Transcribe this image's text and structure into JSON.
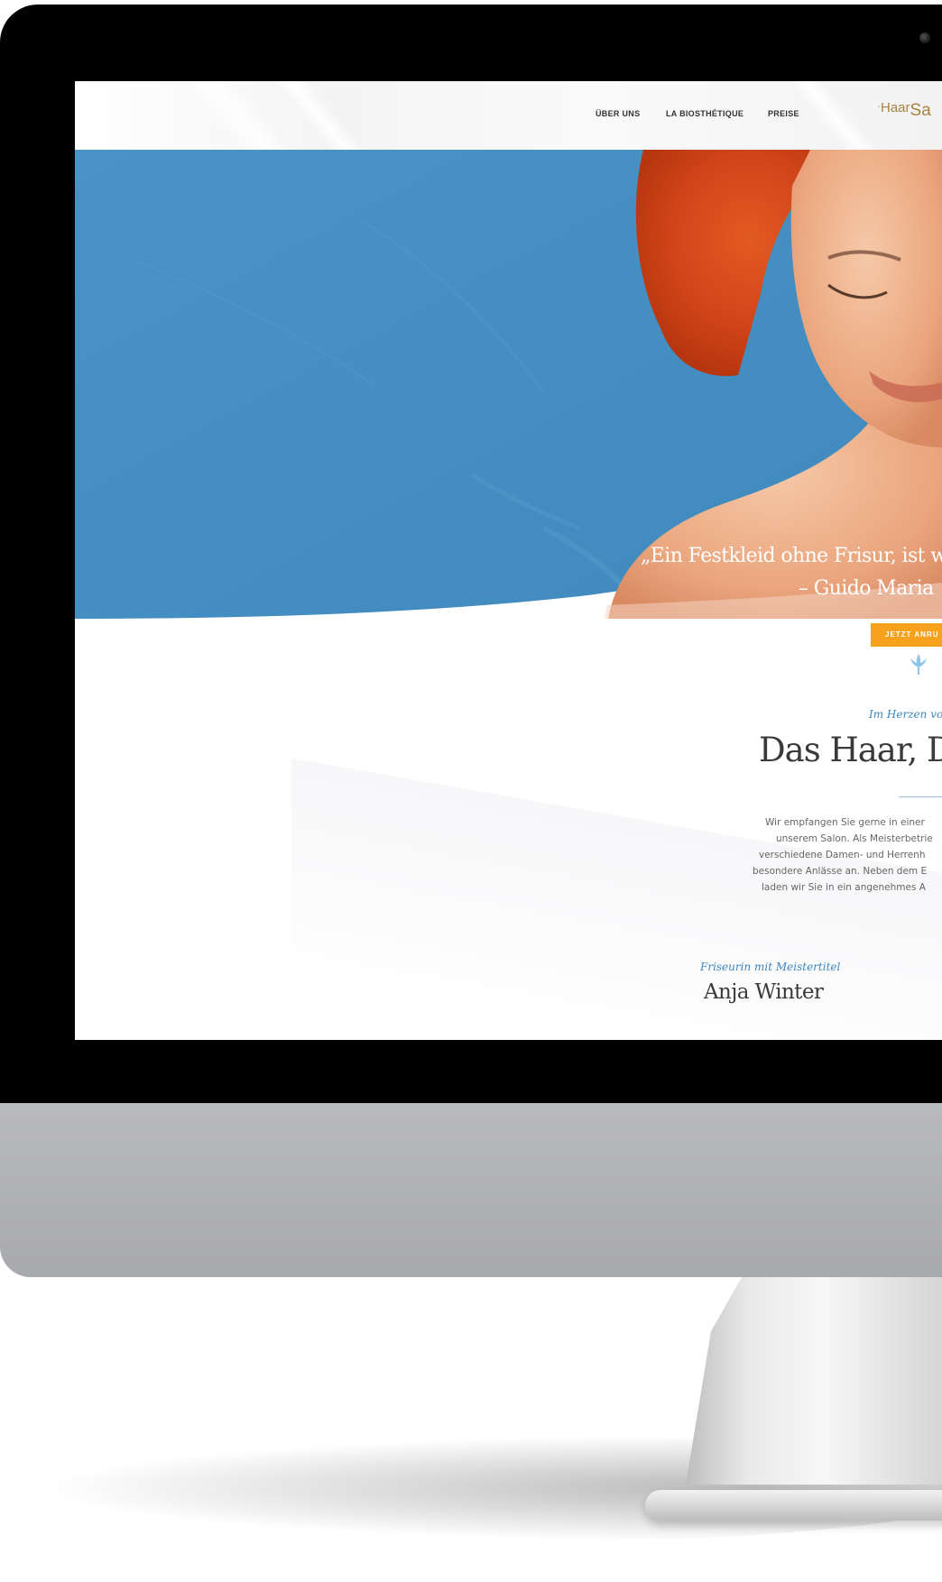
{
  "nav": {
    "items": [
      {
        "label": "ÜBER UNS"
      },
      {
        "label": "LA BIOSTHÉTIQUE"
      },
      {
        "label": "PREISE"
      }
    ]
  },
  "logo": {
    "line1": "Haar",
    "line2": "Sa"
  },
  "hero": {
    "quote_line1": "„Ein Festkleid ohne Frisur, ist wie",
    "quote_line2": "– Guido Maria",
    "cta_label": "JETZT ANRU"
  },
  "intro": {
    "kicker": "Im Herzen von",
    "title": "Das Haar, D",
    "paragraph_lines": [
      "Wir empfangen Sie gerne in einer",
      "unserem Salon. Als Meisterbetrie",
      "verschiedene Damen- und Herrenh",
      "besondere Anlässe an. Neben dem E",
      "laden wir Sie in ein angenehmes A"
    ]
  },
  "team": {
    "role": "Friseurin mit Meistertitel",
    "name": "Anja Winter"
  },
  "colors": {
    "hero_blue": "#4790c3",
    "cta_orange": "#f6a21c",
    "accent_blue": "#3c86bf",
    "logo_gold": "#a8823f"
  },
  "icons": {
    "ornament": "fleur-ornament-icon",
    "camera": "camera-icon"
  }
}
